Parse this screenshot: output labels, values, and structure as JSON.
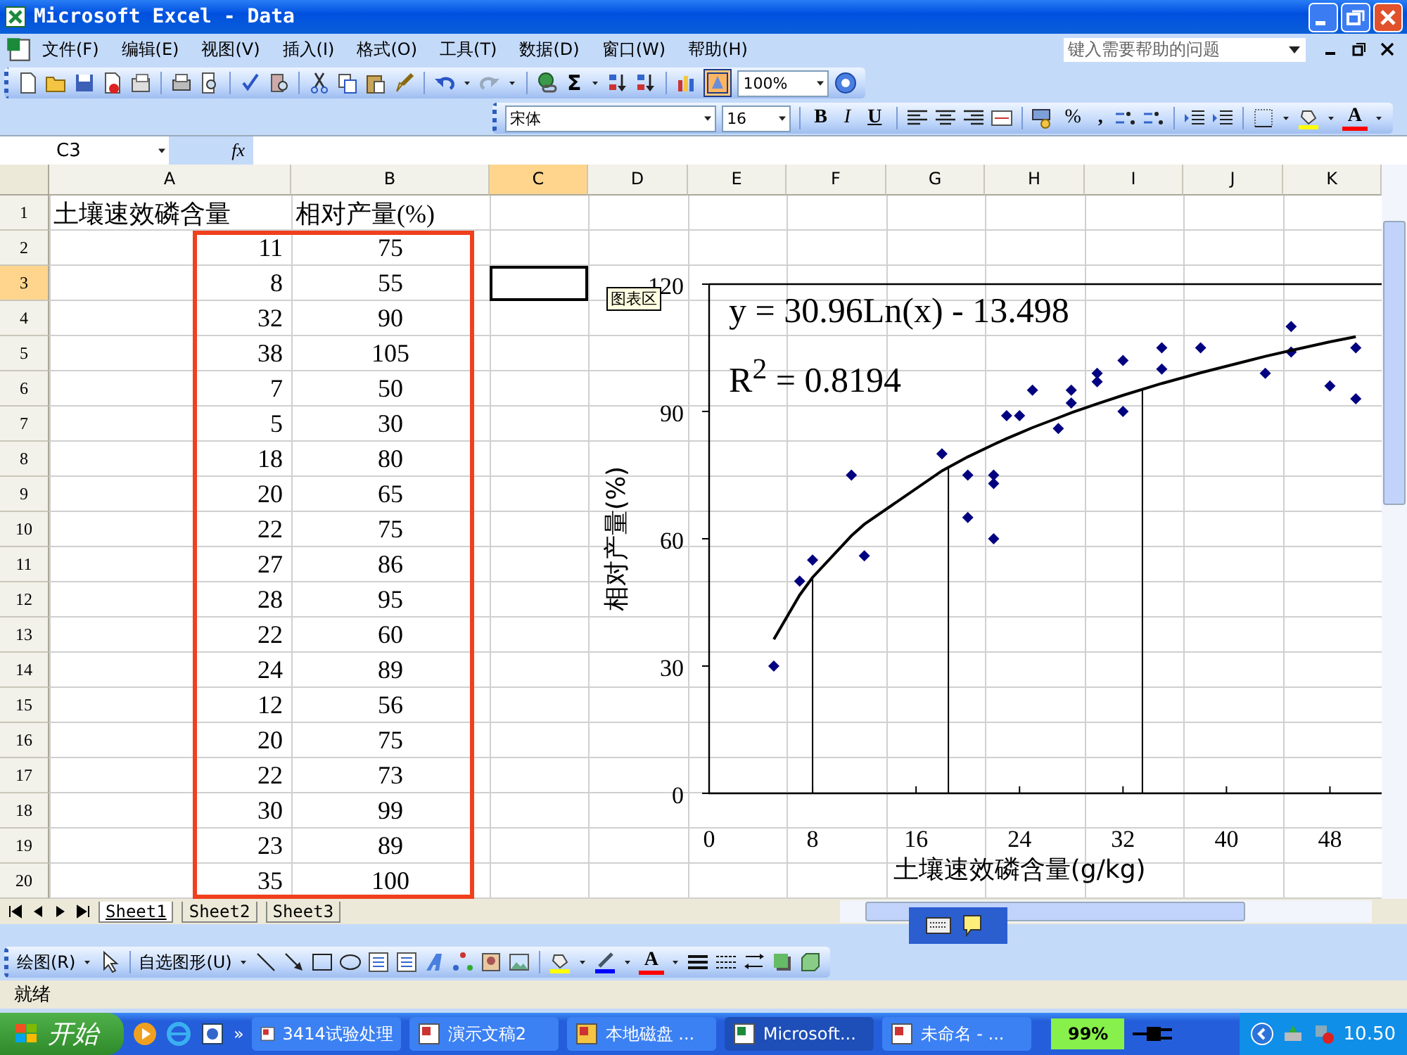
{
  "window": {
    "title": "Microsoft Excel - Data"
  },
  "menu": [
    "文件(F)",
    "编辑(E)",
    "视图(V)",
    "插入(I)",
    "格式(O)",
    "工具(T)",
    "数据(D)",
    "窗口(W)",
    "帮助(H)"
  ],
  "help_search": {
    "placeholder": "键入需要帮助的问题"
  },
  "standard_toolbar": {
    "autosum": "Σ",
    "zoom": "100%"
  },
  "formatting_toolbar": {
    "font": "宋体",
    "size": "16",
    "bold": "B",
    "italic": "I",
    "underline": "U",
    "percent": "%",
    "comma": ",",
    "font_color": "A"
  },
  "formula_bar": {
    "name_box": "C3",
    "fx": "fx"
  },
  "sheet": {
    "columns": [
      {
        "label": "A",
        "selected": false
      },
      {
        "label": "B",
        "selected": false
      },
      {
        "label": "C",
        "selected": true
      },
      {
        "label": "D",
        "selected": false
      },
      {
        "label": "E",
        "selected": false
      },
      {
        "label": "F",
        "selected": false
      },
      {
        "label": "G",
        "selected": false
      },
      {
        "label": "H",
        "selected": false
      },
      {
        "label": "I",
        "selected": false
      },
      {
        "label": "J",
        "selected": false
      },
      {
        "label": "K",
        "selected": false
      }
    ],
    "rows": [
      {
        "number": "1",
        "selected": false,
        "a": "土壤速效磷含量",
        "b": "相对产量(%)",
        "kind": "header"
      },
      {
        "number": "2",
        "selected": false,
        "a": "11",
        "b": "75",
        "kind": "data"
      },
      {
        "number": "3",
        "selected": true,
        "a": "8",
        "b": "55",
        "kind": "data"
      },
      {
        "number": "4",
        "selected": false,
        "a": "32",
        "b": "90",
        "kind": "data"
      },
      {
        "number": "5",
        "selected": false,
        "a": "38",
        "b": "105",
        "kind": "data"
      },
      {
        "number": "6",
        "selected": false,
        "a": "7",
        "b": "50",
        "kind": "data"
      },
      {
        "number": "7",
        "selected": false,
        "a": "5",
        "b": "30",
        "kind": "data"
      },
      {
        "number": "8",
        "selected": false,
        "a": "18",
        "b": "80",
        "kind": "data"
      },
      {
        "number": "9",
        "selected": false,
        "a": "20",
        "b": "65",
        "kind": "data"
      },
      {
        "number": "10",
        "selected": false,
        "a": "22",
        "b": "75",
        "kind": "data"
      },
      {
        "number": "11",
        "selected": false,
        "a": "27",
        "b": "86",
        "kind": "data"
      },
      {
        "number": "12",
        "selected": false,
        "a": "28",
        "b": "95",
        "kind": "data"
      },
      {
        "number": "13",
        "selected": false,
        "a": "22",
        "b": "60",
        "kind": "data"
      },
      {
        "number": "14",
        "selected": false,
        "a": "24",
        "b": "89",
        "kind": "data"
      },
      {
        "number": "15",
        "selected": false,
        "a": "12",
        "b": "56",
        "kind": "data"
      },
      {
        "number": "16",
        "selected": false,
        "a": "20",
        "b": "75",
        "kind": "data"
      },
      {
        "number": "17",
        "selected": false,
        "a": "22",
        "b": "73",
        "kind": "data"
      },
      {
        "number": "18",
        "selected": false,
        "a": "30",
        "b": "99",
        "kind": "data"
      },
      {
        "number": "19",
        "selected": false,
        "a": "23",
        "b": "89",
        "kind": "data"
      },
      {
        "number": "20",
        "selected": false,
        "a": "35",
        "b": "100",
        "kind": "data"
      }
    ]
  },
  "chart": {
    "tooltip": "图表区",
    "equation": "y = 30.96Ln(x) - 13.498",
    "r_squared": "R$^{2}$ = 0.8194",
    "chart_data": {
      "type": "scatter",
      "xlabel": "土壤速效磷含量(g/kg)",
      "ylabel": "相对产量(%)",
      "xlim": [
        0,
        52
      ],
      "ylim": [
        0,
        120
      ],
      "xticks": [
        0,
        8,
        16,
        24,
        32,
        40,
        48
      ],
      "yticks": [
        0,
        30,
        60,
        90,
        120
      ],
      "x": [
        5,
        7,
        8,
        11,
        12,
        18,
        20,
        20,
        22,
        22,
        22,
        23,
        24,
        25,
        27,
        28,
        28,
        30,
        30,
        32,
        32,
        35,
        35,
        38,
        43,
        45,
        45,
        48,
        50,
        50
      ],
      "series": [
        {
          "type": "scatter",
          "color": "#000080",
          "values": [
            30,
            50,
            55,
            75,
            56,
            80,
            75,
            65,
            75,
            73,
            60,
            89,
            89,
            95,
            86,
            95,
            92,
            99,
            97,
            102,
            90,
            105,
            100,
            105,
            99,
            110,
            104,
            96,
            105,
            93
          ]
        },
        {
          "type": "line",
          "color": "#000000",
          "values": [
            36.3,
            46.7,
            50.9,
            60.7,
            63.4,
            76,
            79.3,
            79.3,
            82.2,
            82.2,
            82.2,
            83.6,
            84.9,
            86.2,
            88.5,
            89.7,
            89.7,
            91.8,
            91.8,
            93.8,
            93.8,
            96.6,
            96.6,
            99.1,
            103,
            104.4,
            104.4,
            106.4,
            107.6,
            107.6
          ]
        }
      ],
      "ref_lines": [
        {
          "axis": "x",
          "value": 8
        },
        {
          "axis": "x",
          "value": 18.5
        },
        {
          "axis": "x",
          "value": 33.5
        }
      ]
    }
  },
  "sheet_tabs": [
    {
      "label": "Sheet1",
      "selected": true
    },
    {
      "label": "Sheet2",
      "selected": false
    },
    {
      "label": "Sheet3",
      "selected": false
    }
  ],
  "drawing_toolbar": {
    "draw_menu": "绘图(R)",
    "autoshapes": "自选图形(U)",
    "font_color": "A"
  },
  "status_bar": {
    "text": "就绪"
  },
  "taskbar": {
    "start": "开始",
    "more": "»",
    "items": [
      {
        "label": "3414试验处理",
        "selected": false
      },
      {
        "label": "演示文稿2",
        "selected": false
      },
      {
        "label": "本地磁盘 ...",
        "selected": false
      },
      {
        "label": "Microsoft...",
        "selected": true
      },
      {
        "label": "未命名 - ...",
        "selected": false
      }
    ],
    "battery": "99%",
    "clock": "10.50"
  }
}
